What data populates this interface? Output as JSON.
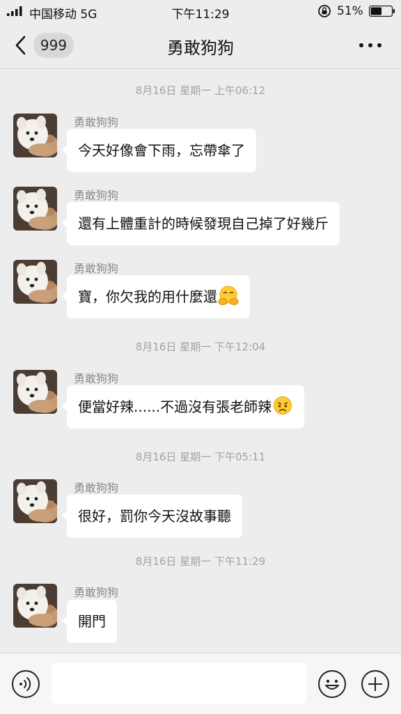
{
  "status": {
    "carrier": "中国移动 5G",
    "time": "下午11:29",
    "battery": "51%"
  },
  "nav": {
    "unread_count": "999",
    "title": "勇敢狗狗"
  },
  "messages": [
    {
      "type": "time",
      "text": "8月16日 星期一 上午06:12"
    },
    {
      "type": "msg",
      "sender": "勇敢狗狗",
      "text": "今天好像會下雨，忘帶傘了"
    },
    {
      "type": "msg",
      "sender": "勇敢狗狗",
      "text": "還有上體重計的時候發現自己掉了好幾斤"
    },
    {
      "type": "msg",
      "sender": "勇敢狗狗",
      "text": "寶，你欠我的用什麼還",
      "emoji": "pleading-hands-emoji"
    },
    {
      "type": "time",
      "text": "8月16日 星期一 下午12:04"
    },
    {
      "type": "msg",
      "sender": "勇敢狗狗",
      "text": "便當好辣......不過沒有張老師辣",
      "emoji": "sad-face-emoji"
    },
    {
      "type": "time",
      "text": "8月16日 星期一 下午05:11"
    },
    {
      "type": "msg",
      "sender": "勇敢狗狗",
      "text": "很好，罰你今天沒故事聽"
    },
    {
      "type": "time",
      "text": "8月16日 星期一 下午11:29"
    },
    {
      "type": "msg",
      "sender": "勇敢狗狗",
      "text": "開門"
    }
  ],
  "colors": {
    "background": "#ededed",
    "bubble": "#ffffff",
    "timestamp": "#a2a2a2",
    "sender": "#8a8a8a"
  },
  "icons": [
    "signal-icon",
    "rotation-lock-icon",
    "battery-icon",
    "back-icon",
    "more-icon",
    "voice-icon",
    "emoji-icon",
    "plus-icon"
  ]
}
